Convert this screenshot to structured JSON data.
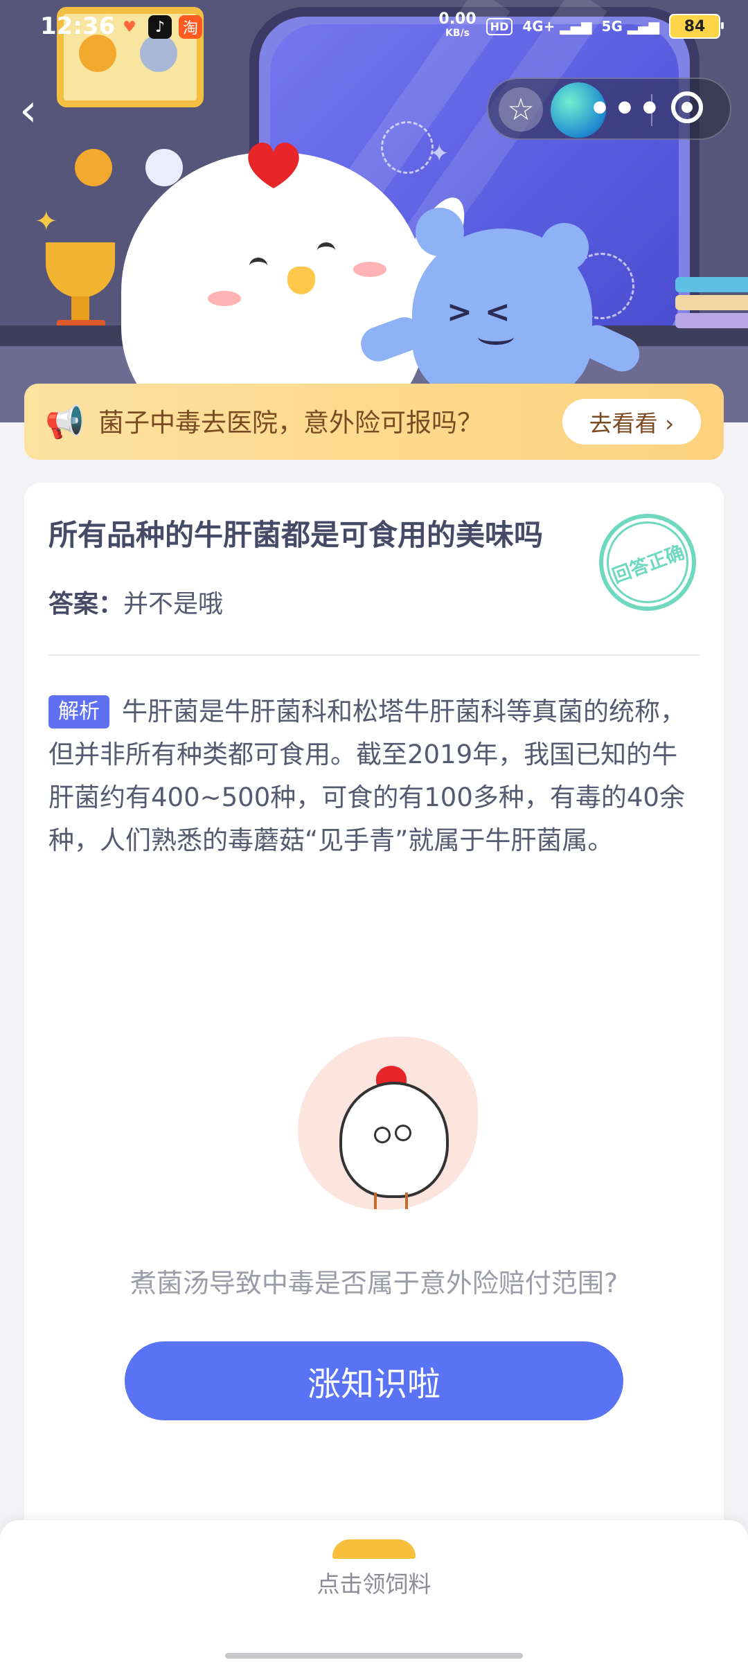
{
  "status_bar": {
    "time": "12:36",
    "net_speed_value": "0.00",
    "net_speed_unit": "KB/s",
    "hd_label": "HD",
    "signal_1": "4G+",
    "signal_2": "5G",
    "battery": "84"
  },
  "header": {
    "back_icon": "chevron-left-icon",
    "favorite_icon": "star-icon",
    "more_label": "•••",
    "target_icon": "target-icon"
  },
  "banner": {
    "text": "菌子中毒去医院，意外险可报吗？",
    "button_label": "去看看 ›",
    "icon": "megaphone-icon"
  },
  "card": {
    "question": "所有品种的牛肝菌都是可食用的美味吗",
    "stamp_text": "回答正确",
    "answer_label": "答案：",
    "answer_value": "并不是哦",
    "analysis_tag": "解析",
    "analysis_text": "牛肝菌是牛肝菌科和松塔牛肝菌科等真菌的统称，但并非所有种类都可食用。截至2019年，我国已知的牛肝菌约有400~500种，可食的有100多种，有毒的40余种，人们熟悉的毒蘑菇“见手青”就属于牛肝菌属。",
    "tip": "煮菌汤导致中毒是否属于意外险赔付范围?",
    "button_label": "涨知识啦"
  },
  "bottom_bar": {
    "label": "点击领饲料",
    "icon": "feed-bowl-icon"
  }
}
